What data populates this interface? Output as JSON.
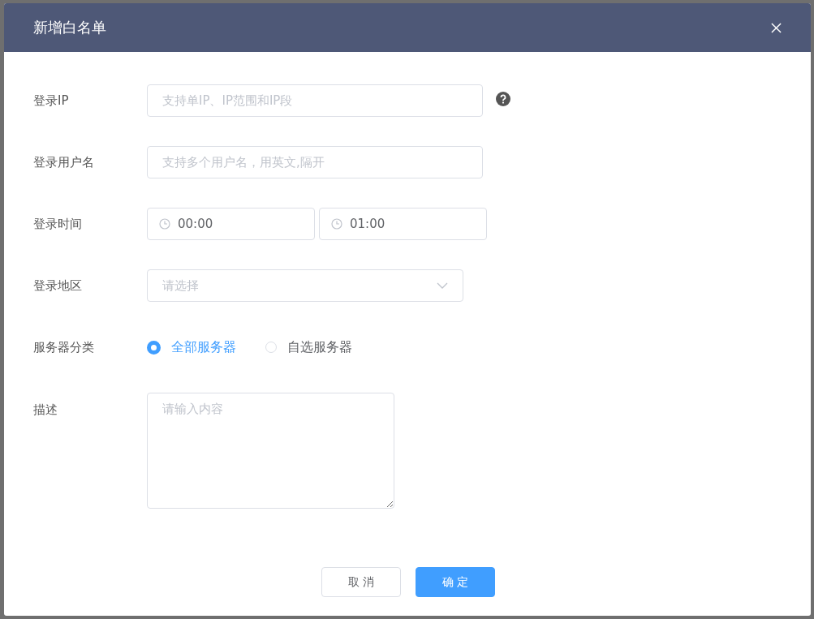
{
  "dialog": {
    "title": "新增白名单"
  },
  "fields": [
    {
      "kind": "text",
      "label": "登录IP",
      "placeholder": "支持单IP、IP范围和IP段",
      "help": true
    },
    {
      "kind": "text",
      "label": "登录用户名",
      "placeholder": "支持多个用户名，用英文,隔开"
    },
    {
      "kind": "time_range",
      "label": "登录时间",
      "start": "00:00",
      "end": "01:00"
    },
    {
      "kind": "select",
      "label": "登录地区",
      "placeholder": "请选择"
    },
    {
      "kind": "radio",
      "label": "服务器分类",
      "options": [
        {
          "label": "全部服务器",
          "selected": true
        },
        {
          "label": "自选服务器",
          "selected": false
        }
      ]
    },
    {
      "kind": "textarea",
      "label": "描述",
      "placeholder": "请输入内容"
    }
  ],
  "buttons": [
    {
      "label": "取 消",
      "kind": "default"
    },
    {
      "label": "确 定",
      "kind": "primary"
    }
  ]
}
